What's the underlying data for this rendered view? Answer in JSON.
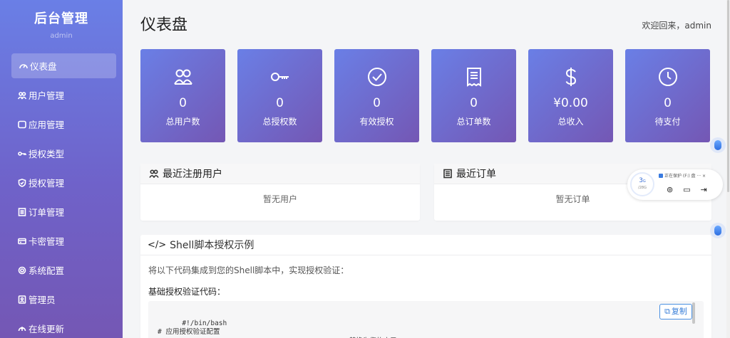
{
  "brand": {
    "title": "后台管理",
    "user": "admin"
  },
  "sidebar": {
    "items": [
      {
        "label": "仪表盘",
        "icon": "dashboard-icon",
        "active": true
      },
      {
        "label": "用户管理",
        "icon": "users-icon"
      },
      {
        "label": "应用管理",
        "icon": "app-icon"
      },
      {
        "label": "授权类型",
        "icon": "key-icon"
      },
      {
        "label": "授权管理",
        "icon": "shield-icon"
      },
      {
        "label": "订单管理",
        "icon": "receipt-icon"
      },
      {
        "label": "卡密管理",
        "icon": "card-icon"
      },
      {
        "label": "系统配置",
        "icon": "gear-icon"
      },
      {
        "label": "管理员",
        "icon": "admin-icon"
      },
      {
        "label": "在线更新",
        "icon": "update-icon"
      }
    ]
  },
  "header": {
    "title": "仪表盘",
    "welcome": "欢迎回来，admin"
  },
  "stats": [
    {
      "value": "0",
      "label": "总用户数",
      "icon": "users-icon"
    },
    {
      "value": "0",
      "label": "总授权数",
      "icon": "key-icon"
    },
    {
      "value": "0",
      "label": "有效授权",
      "icon": "check-circle-icon"
    },
    {
      "value": "0",
      "label": "总订单数",
      "icon": "receipt-icon"
    },
    {
      "value": "¥0.00",
      "label": "总收入",
      "icon": "dollar-icon"
    },
    {
      "value": "0",
      "label": "待支付",
      "icon": "clock-icon"
    }
  ],
  "recent_users": {
    "title": "最近注册用户",
    "empty": "暂无用户"
  },
  "recent_orders": {
    "title": "最近订单",
    "empty": "暂无订单"
  },
  "shell": {
    "title": "Shell脚本授权示例",
    "description": "将以下代码集成到您的Shell脚本中，实现授权验证：",
    "subtitle": "基础授权验证代码：",
    "code": "#!/bin/bash\n# 应用授权验证配置\nAPP_ID=\"YOUR_APP_ID_HERE\"                    # 替换为您的应用ID",
    "copy_label": "复制"
  },
  "widget": {
    "ring_value": "3",
    "ring_unit": "G",
    "ring_total": "/28G",
    "status": "正在保护 (F:) 盘 ··· ×"
  },
  "colors": {
    "accent_start": "#6a7fe6",
    "accent_end": "#7457b4",
    "link": "#3a7fd8"
  }
}
